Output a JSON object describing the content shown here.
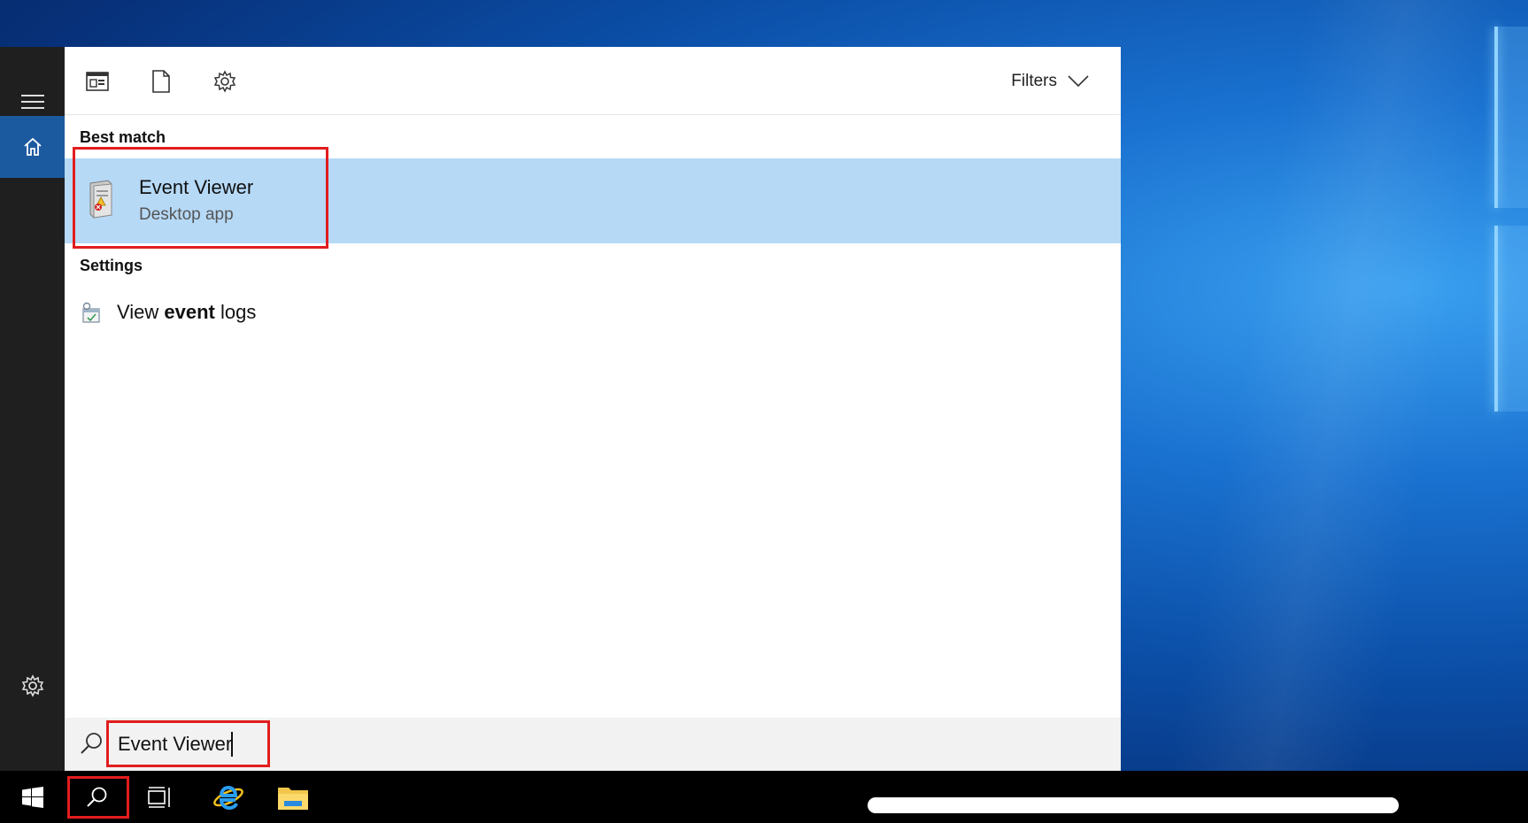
{
  "toolbar": {
    "filters_label": "Filters"
  },
  "sections": {
    "best_match": "Best match",
    "settings": "Settings"
  },
  "best_match_result": {
    "title": "Event Viewer",
    "subtitle": "Desktop app"
  },
  "settings_result": {
    "prefix": "View ",
    "bold": "event",
    "suffix": " logs"
  },
  "search": {
    "value": "Event Viewer"
  },
  "icons": {
    "rail": [
      "hamburger-icon",
      "home-icon",
      "settings-gear-icon"
    ],
    "toolbar": [
      "apps-icon",
      "documents-icon",
      "settings-icon",
      "chevron-down-icon"
    ],
    "taskbar": [
      "windows-start-icon",
      "search-icon",
      "task-view-icon",
      "internet-explorer-icon",
      "file-explorer-icon"
    ]
  },
  "colors": {
    "highlight": "#b6d9f6",
    "rail": "#1f1f1f",
    "home_active": "#1c5aa0",
    "annotation": "#e21d1d"
  }
}
